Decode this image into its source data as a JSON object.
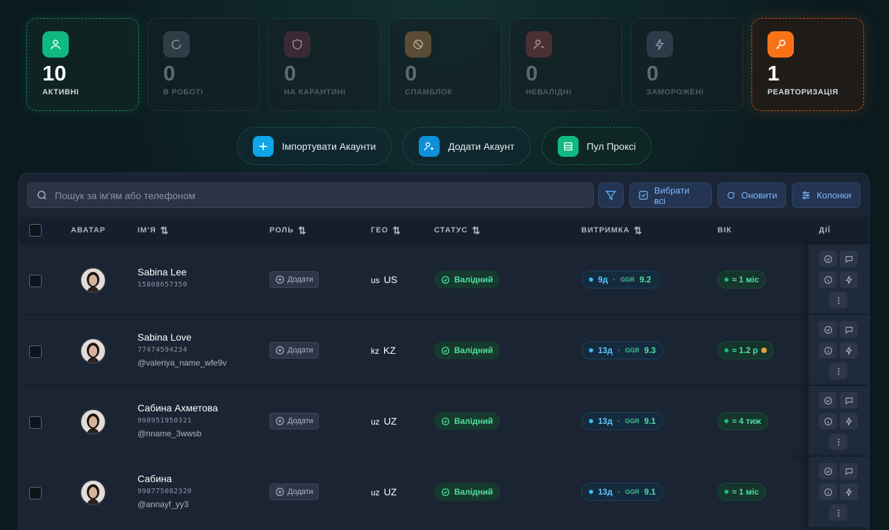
{
  "stats": [
    {
      "value": "10",
      "label": "АКТИВНІ",
      "icon": "user-icon",
      "accent": "#10b981"
    },
    {
      "value": "0",
      "label": "В РОБОТІ",
      "icon": "refresh-icon",
      "accent": "#2f3d46"
    },
    {
      "value": "0",
      "label": "НА КАРАНТИНІ",
      "icon": "shield-icon",
      "accent": "#3b2a33"
    },
    {
      "value": "0",
      "label": "СПАМБЛОК",
      "icon": "ban-icon",
      "accent": "#5a4c36"
    },
    {
      "value": "0",
      "label": "НЕВАЛІДНІ",
      "icon": "user-minus-icon",
      "accent": "#4a2f34"
    },
    {
      "value": "0",
      "label": "ЗАМОРОЖЕНІ",
      "icon": "bolt-icon",
      "accent": "#2f3a48"
    },
    {
      "value": "1",
      "label": "РЕАВТОРИЗАЦІЯ",
      "icon": "key-icon",
      "accent": "#f97316"
    }
  ],
  "actions": {
    "import": "Імпортувати Акаунти",
    "add": "Додати Акаунт",
    "proxy": "Пул Проксі"
  },
  "toolbar": {
    "search_placeholder": "Пошук за ім'ям або телефоном",
    "select_all": "Вибрати всі",
    "refresh": "Оновити",
    "columns": "Колонки"
  },
  "columns": {
    "avatar": "АВАТАР",
    "name": "ІМ'Я",
    "role": "РОЛЬ",
    "geo": "ГЕО",
    "status": "СТАТУС",
    "vitrimka": "ВИТРИМКА",
    "age": "ВІК",
    "actions": "ДІЇ"
  },
  "rows": [
    {
      "name": "Sabina Lee",
      "phone": "15808657350",
      "username": "",
      "role": "Додати",
      "geo_code": "us",
      "geo": "US",
      "status": "Валідний",
      "days": "9д",
      "ggr_label": "GGR",
      "ggr": "9.2",
      "age": "≈ 1 міс"
    },
    {
      "name": "Sabina Love",
      "phone": "77474594234",
      "username": "@valeriya_name_wfe9v",
      "role": "Додати",
      "geo_code": "kz",
      "geo": "KZ",
      "status": "Валідний",
      "days": "13д",
      "ggr_label": "GGR",
      "ggr": "9.3",
      "age": "≈ 1.2 р"
    },
    {
      "name": "Сабина Ахметова",
      "phone": "998951950321",
      "username": "@nname_3wwsb",
      "role": "Додати",
      "geo_code": "uz",
      "geo": "UZ",
      "status": "Валідний",
      "days": "13д",
      "ggr_label": "GGR",
      "ggr": "9.1",
      "age": "≈ 4 тиж"
    },
    {
      "name": "Сабина",
      "phone": "998775082320",
      "username": "@annayf_yy3",
      "role": "Додати",
      "geo_code": "uz",
      "geo": "UZ",
      "status": "Валідний",
      "days": "13д",
      "ggr_label": "GGR",
      "ggr": "9.1",
      "age": "≈ 1 міс"
    }
  ]
}
